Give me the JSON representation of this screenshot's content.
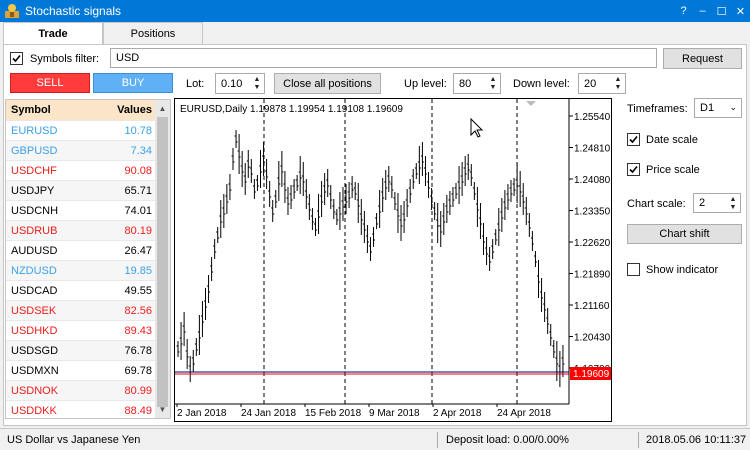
{
  "window": {
    "title": "Stochastic signals",
    "help": "?",
    "minimize": "–",
    "maximize": "☐",
    "close": "✕"
  },
  "tabs": [
    {
      "label": "Trade"
    },
    {
      "label": "Positions"
    }
  ],
  "filter": {
    "label": "Symbols filter:",
    "value": "USD",
    "checked": true,
    "request_label": "Request"
  },
  "trade": {
    "sell_label": "SELL",
    "buy_label": "BUY",
    "sell_color": "#ff3b3b",
    "buy_color": "#5fb0f5",
    "lot_label": "Lot:",
    "lot_value": "0.10",
    "close_all_label": "Close all positions",
    "up_label": "Up level:",
    "up_value": "80",
    "down_label": "Down level:",
    "down_value": "20"
  },
  "symbols": {
    "header_symbol": "Symbol",
    "header_values": "Values",
    "rows": [
      {
        "name": "EURUSD",
        "value": "10.78",
        "color": "#3aa0e8"
      },
      {
        "name": "GBPUSD",
        "value": "7.34",
        "color": "#3aa0e8"
      },
      {
        "name": "USDCHF",
        "value": "90.08",
        "color": "#ee1c1c"
      },
      {
        "name": "USDJPY",
        "value": "65.71",
        "color": "#000000"
      },
      {
        "name": "USDCNH",
        "value": "74.01",
        "color": "#000000"
      },
      {
        "name": "USDRUB",
        "value": "80.19",
        "color": "#ee1c1c"
      },
      {
        "name": "AUDUSD",
        "value": "26.47",
        "color": "#000000"
      },
      {
        "name": "NZDUSD",
        "value": "19.85",
        "color": "#3aa0e8"
      },
      {
        "name": "USDCAD",
        "value": "49.55",
        "color": "#000000"
      },
      {
        "name": "USDSEK",
        "value": "82.56",
        "color": "#ee1c1c"
      },
      {
        "name": "USDHKD",
        "value": "89.43",
        "color": "#ee1c1c"
      },
      {
        "name": "USDSGD",
        "value": "76.78",
        "color": "#000000"
      },
      {
        "name": "USDMXN",
        "value": "69.78",
        "color": "#000000"
      },
      {
        "name": "USDNOK",
        "value": "80.99",
        "color": "#ee1c1c"
      },
      {
        "name": "USDDKK",
        "value": "88.49",
        "color": "#ee1c1c"
      }
    ]
  },
  "chart": {
    "info": "EURUSD,Daily  1.19878 1.19954 1.19108 1.19609",
    "price_labels": [
      "1.25540",
      "1.24810",
      "1.24080",
      "1.23350",
      "1.22620",
      "1.21890",
      "1.21160",
      "1.20430",
      "1.19700"
    ],
    "current_price": "1.19609",
    "date_labels": [
      "2 Jan 2018",
      "24 Jan 2018",
      "15 Feb 2018",
      "9 Mar 2018",
      "2 Apr 2018",
      "24 Apr 2018"
    ],
    "price_line_color": "#ff0000",
    "bid_line_color": "#000080"
  },
  "right_panel": {
    "timeframes_label": "Timeframes:",
    "timeframe_value": "D1",
    "date_scale_label": "Date scale",
    "date_scale_checked": true,
    "price_scale_label": "Price scale",
    "price_scale_checked": true,
    "chart_scale_label": "Chart scale:",
    "chart_scale_value": "2",
    "chart_shift_label": "Chart shift",
    "show_indicator_label": "Show indicator",
    "show_indicator_checked": false
  },
  "status": {
    "left": "US Dollar vs Japanese Yen",
    "middle": "Deposit load: 0.00/0.00%",
    "right": "2018.05.06 10:11:37"
  }
}
